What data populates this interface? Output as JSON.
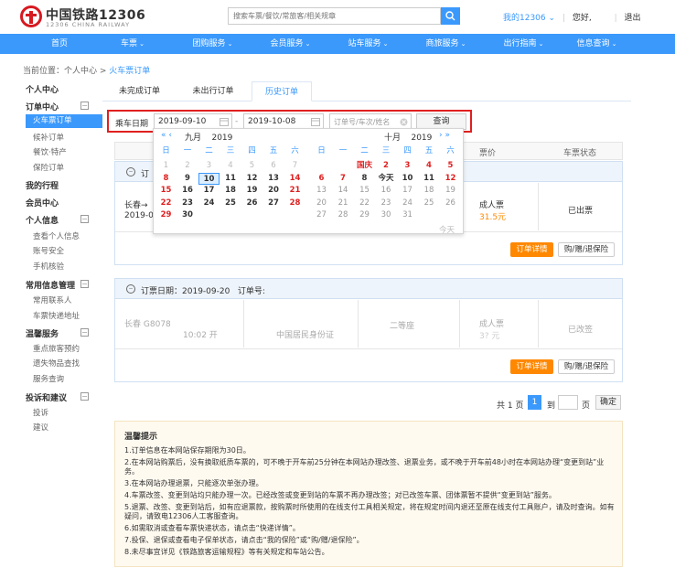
{
  "header": {
    "logo_cn": "中国铁路12306",
    "logo_en": "12306 CHINA RAILWAY",
    "search_placeholder": "搜索车票/餐饮/常旅客/相关规章",
    "my12306": "我的12306",
    "my12306_caret": "⌄",
    "greeting": "您好,",
    "logout": "退出"
  },
  "nav": [
    {
      "label": "首页",
      "caret": ""
    },
    {
      "label": "车票",
      "caret": "⌄"
    },
    {
      "label": "团购服务",
      "caret": "⌄"
    },
    {
      "label": "会员服务",
      "caret": "⌄"
    },
    {
      "label": "站车服务",
      "caret": "⌄"
    },
    {
      "label": "商旅服务",
      "caret": "⌄"
    },
    {
      "label": "出行指南",
      "caret": "⌄"
    },
    {
      "label": "信息查询",
      "caret": "⌄"
    }
  ],
  "breadcrumb": {
    "prefix": "当前位置：个人中心 > ",
    "current": "火车票订单"
  },
  "sidebar": {
    "personal_center": "个人中心",
    "order_center": "订单中心",
    "train_orders": "火车票订单",
    "waitlist_orders": "候补订单",
    "food_orders": "餐饮·特产",
    "insurance_orders": "保险订单",
    "my_trips": "我的行程",
    "member_center": "会员中心",
    "personal_info": "个人信息",
    "view_info": "查看个人信息",
    "account_security": "账号安全",
    "phone_verify": "手机核验",
    "common_info": "常用信息管理",
    "contacts": "常用联系人",
    "express_address": "车票快递地址",
    "warm_service": "温馨服务",
    "key_passenger": "重点旅客预约",
    "lost_items": "遗失物品查找",
    "service_query": "服务查询",
    "complaint": "投诉和建议",
    "complaint_sub": "投诉",
    "suggestion": "建议",
    "expand_mark": "−"
  },
  "tabs": {
    "unfinished": "未完成订单",
    "not_traveled": "未出行订单",
    "history": "历史订单"
  },
  "filter": {
    "label": "乘车日期",
    "start_date": "2019-09-10",
    "dash": "-",
    "end_date": "2019-10-08",
    "order_placeholder": "订单号/车次/姓名",
    "query_button": "查询"
  },
  "table_head": {
    "price_col": "票价",
    "status_col": "车票状态"
  },
  "calendar": {
    "prev_arrows": "« ‹",
    "next_arrows": "› »",
    "left_month": "九月",
    "left_year": "2019",
    "right_month": "十月",
    "right_year": "2019",
    "weekdays": [
      "日",
      "一",
      "二",
      "三",
      "四",
      "五",
      "六"
    ],
    "today_label": "今天",
    "holiday_label": "国庆",
    "left_days": [
      [
        "1",
        "2",
        "3",
        "4",
        "5",
        "6",
        "7"
      ],
      [
        "8",
        "9",
        "10",
        "11",
        "12",
        "13",
        "14"
      ],
      [
        "15",
        "16",
        "17",
        "18",
        "19",
        "20",
        "21"
      ],
      [
        "22",
        "23",
        "24",
        "25",
        "26",
        "27",
        "28"
      ],
      [
        "29",
        "30",
        "",
        "",
        "",
        "",
        ""
      ]
    ],
    "right_days": [
      [
        "",
        "",
        "国庆",
        "2",
        "3",
        "4",
        "5"
      ],
      [
        "6",
        "7",
        "8",
        "今天",
        "10",
        "11",
        "12"
      ],
      [
        "13",
        "14",
        "15",
        "16",
        "17",
        "18",
        "19"
      ],
      [
        "20",
        "21",
        "22",
        "23",
        "24",
        "25",
        "26"
      ],
      [
        "27",
        "28",
        "29",
        "30",
        "31",
        "",
        ""
      ]
    ]
  },
  "order1": {
    "header_label": "订",
    "route": "长春→",
    "date": "2019-0",
    "ticket_type": "成人票",
    "price": "31.5元",
    "status": "已出票",
    "detail_button": "订单详情",
    "refund_button": "购/赠/退保险"
  },
  "order2": {
    "order_date_label": "订票日期：",
    "order_date": "2019-09-20",
    "order_no_label": "订单号:",
    "route": "长春",
    "train": "G8078",
    "depart_time": "10:02 开",
    "id_type": "中国居民身份证",
    "seat": "二等座",
    "ticket_type": "成人票",
    "price": "3? 元",
    "status": "已改签",
    "detail_button": "订单详情",
    "refund_button": "购/赠/退保险"
  },
  "pagination": {
    "total": "共 1 页",
    "current": "1",
    "to": "到",
    "page": "页",
    "confirm": "确定"
  },
  "tips": {
    "title": "温馨提示",
    "items": [
      "1.订单信息在本网站保存期限为30日。",
      "2.在本网站购票后，没有换取纸质车票的，可不晚于开车前25分钟在本网站办理改签、退票业务，或不晚于开车前48小时在本网站办理“变更到站”业务。",
      "3.在本网站办理退票，只能逐次单张办理。",
      "4.车票改签、变更到站均只能办理一次。已经改签或变更到站的车票不再办理改签；对已改签车票、团体票暂不提供“变更到站”服务。",
      "5.退票、改签、变更到站后，如有应退票款，按购票时所使用的在线支付工具相关规定，将在规定时间内退还至原在线支付工具账户，请及时查询。如有疑问，请致电12306人工客服查询。",
      "6.如需取消或查看车票快递状态，请点击“快递详情”。",
      "7.投保、退保或查看电子保单状态，请点击“我的保险”或“购/赠/退保险”。",
      "8.未尽事宜详见《铁路旅客运输规程》等有关规定和车站公告。"
    ]
  },
  "colors": {
    "brand_blue": "#3b99fc",
    "logo_red": "#d71920",
    "order_orange": "#ff8800",
    "weekend_red": "#e02020",
    "filter_outline": "#e02020"
  }
}
